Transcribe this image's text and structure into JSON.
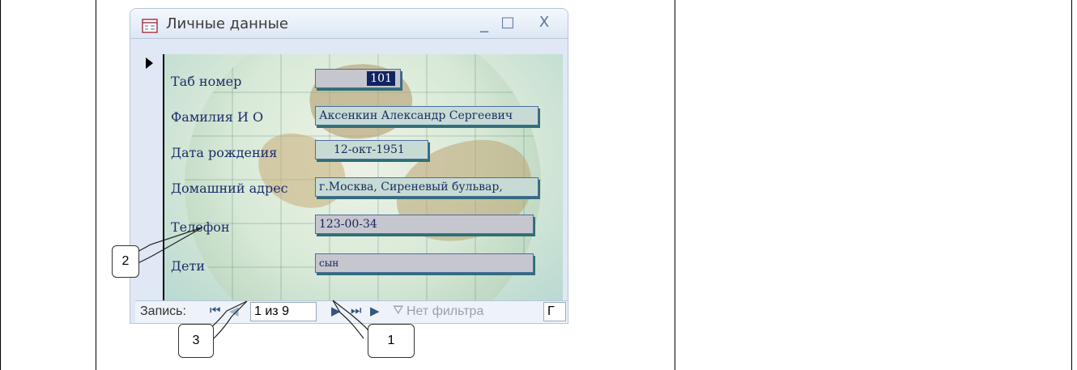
{
  "form": {
    "title": "Личные данные",
    "icon": "form-view-icon",
    "controls": {
      "minimize": "_",
      "maximize": "□",
      "close": "X"
    },
    "fields": [
      {
        "label": "Таб номер",
        "value": "101"
      },
      {
        "label": "Фамилия И О",
        "value": "Аксенкин Александр Сергеевич"
      },
      {
        "label": "Дата рождения",
        "value": "12-окт-1951"
      },
      {
        "label": "Домашний адрес",
        "value": "г.Москва, Сиреневый бульвар,"
      },
      {
        "label": "Телефон",
        "value": "123-00-34"
      },
      {
        "label": "Дети",
        "value": "сын"
      }
    ]
  },
  "navigation": {
    "label": "Запись:",
    "first_icon": "first-record-icon",
    "previous_icon": "previous-record-icon",
    "current_record": "1 из 9",
    "next_icon": "next-record-icon",
    "last_icon": "last-record-icon",
    "new_icon": "new-record-icon",
    "filter_icon": "filter-icon",
    "filter_text": "Нет фильтра",
    "search_text": "Г"
  },
  "callouts": {
    "one": "1",
    "two": "2",
    "three": "3"
  }
}
